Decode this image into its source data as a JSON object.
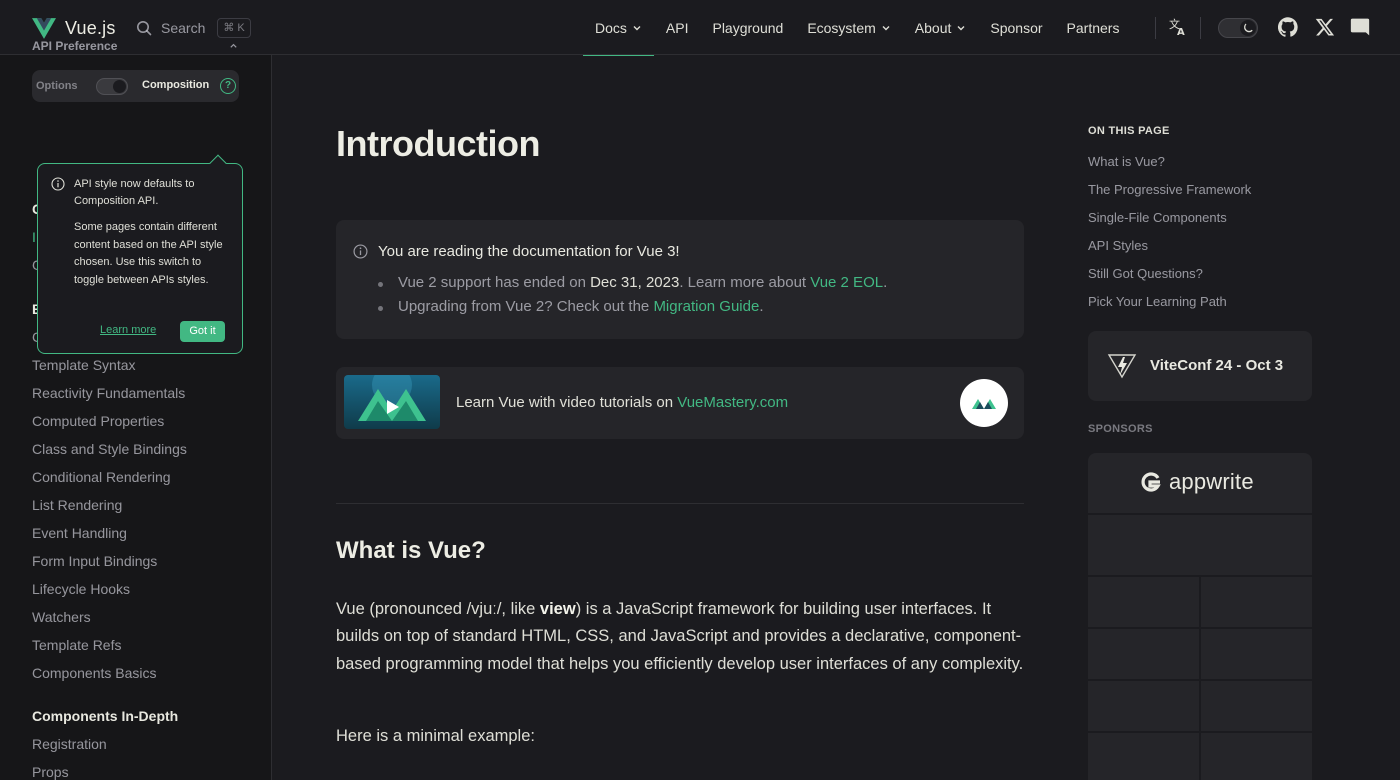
{
  "header": {
    "site_name": "Vue.js",
    "search_label": "Search",
    "search_shortcut": "⌘ K",
    "nav": [
      {
        "label": "Docs",
        "has_dropdown": true,
        "active": true
      },
      {
        "label": "API",
        "has_dropdown": false
      },
      {
        "label": "Playground",
        "has_dropdown": false
      },
      {
        "label": "Ecosystem",
        "has_dropdown": true
      },
      {
        "label": "About",
        "has_dropdown": true
      },
      {
        "label": "Sponsor",
        "has_dropdown": false
      },
      {
        "label": "Partners",
        "has_dropdown": false
      }
    ],
    "icons": [
      "translate-icon",
      "theme-toggle",
      "github-icon",
      "x-icon",
      "discord-icon"
    ]
  },
  "sidebar": {
    "api_preference_title": "API Preference",
    "option_options": "Options",
    "option_composition": "Composition",
    "help_symbol": "?",
    "popup": {
      "line1": "API style now defaults to Composition API.",
      "line2": "Some pages contain different content based on the API style chosen. Use this switch to toggle between APIs styles.",
      "learn_more": "Learn more",
      "got_it": "Got it"
    },
    "fragments": [
      "G",
      "I",
      "G",
      "E",
      "C"
    ],
    "essentials_items": [
      "Template Syntax",
      "Reactivity Fundamentals",
      "Computed Properties",
      "Class and Style Bindings",
      "Conditional Rendering",
      "List Rendering",
      "Event Handling",
      "Form Input Bindings",
      "Lifecycle Hooks",
      "Watchers",
      "Template Refs",
      "Components Basics"
    ],
    "components_heading": "Components In-Depth",
    "components_items": [
      "Registration",
      "Props"
    ]
  },
  "main": {
    "title": "Introduction",
    "tip": {
      "title": "You are reading the documentation for Vue 3!",
      "li1_a": "Vue 2 support has ended on ",
      "li1_b": "Dec 31, 2023",
      "li1_c": ". Learn more about ",
      "li1_link": "Vue 2 EOL",
      "li1_d": ".",
      "li2_a": "Upgrading from Vue 2? Check out the ",
      "li2_link": "Migration Guide",
      "li2_b": "."
    },
    "vuemastery": {
      "text": "Learn Vue with video tutorials on ",
      "link": "VueMastery.com"
    },
    "section_title": "What is Vue?",
    "para_a": "Vue (pronounced /vjuː/, like ",
    "para_bold": "view",
    "para_b": ") is a JavaScript framework for building user interfaces. It builds on top of standard HTML, CSS, and JavaScript and provides a declarative, component-based programming model that helps you efficiently develop user interfaces of any complexity.",
    "para2": "Here is a minimal example:"
  },
  "aside": {
    "on_this_page": "ON THIS PAGE",
    "links": [
      "What is Vue?",
      "The Progressive Framework",
      "Single-File Components",
      "API Styles",
      "Still Got Questions?",
      "Pick Your Learning Path"
    ],
    "viteconf": "ViteConf 24 - Oct 3",
    "sponsors_title": "SPONSORS",
    "sponsor_top": "appwrite"
  },
  "colors": {
    "accent": "#42b883",
    "bg": "#1b1b1f",
    "sidebar_bg": "#161618",
    "card_bg": "#252529"
  }
}
